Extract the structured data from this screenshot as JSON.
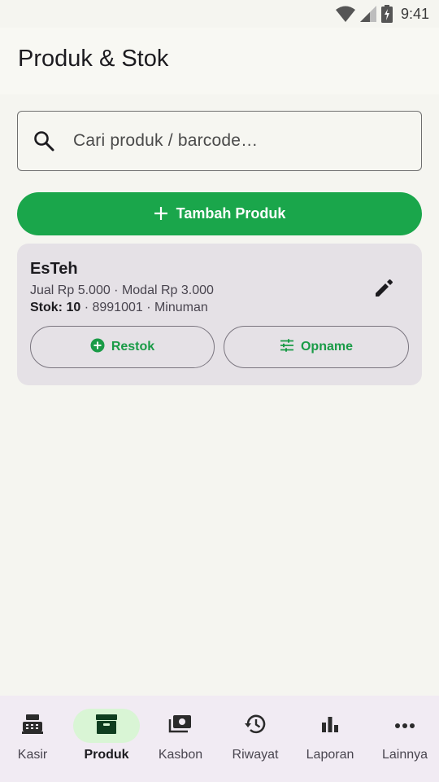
{
  "status_bar": {
    "time": "9:41",
    "icons": [
      "wifi-icon",
      "signal-icon",
      "battery-charging-icon"
    ]
  },
  "app_bar": {
    "title": "Produk & Stok"
  },
  "search": {
    "placeholder": "Cari produk / barcode…",
    "icon": "search-icon"
  },
  "add_button": {
    "label": "Tambah Produk",
    "icon": "plus-icon"
  },
  "products": [
    {
      "name": "EsTeh",
      "price_line": "Jual Rp 5.000 · Modal Rp 3.000",
      "stock_label": "Stok: 10",
      "stock_rest": " · 8991001 · Minuman",
      "restock_label": "Restok",
      "opname_label": "Opname"
    }
  ],
  "bottom_nav": {
    "items": [
      {
        "label": "Kasir",
        "icon": "cash-register-icon",
        "active": false
      },
      {
        "label": "Produk",
        "icon": "archive-box-icon",
        "active": true
      },
      {
        "label": "Kasbon",
        "icon": "money-icon",
        "active": false
      },
      {
        "label": "Riwayat",
        "icon": "history-icon",
        "active": false
      },
      {
        "label": "Laporan",
        "icon": "bar-chart-icon",
        "active": false
      },
      {
        "label": "Lainnya",
        "icon": "more-horizontal-icon",
        "active": false
      }
    ]
  },
  "colors": {
    "primary": "#1aa64b",
    "card": "#e5e1e6",
    "nav_background": "#f1ebf3",
    "nav_active_pill": "#d9f5d5"
  }
}
